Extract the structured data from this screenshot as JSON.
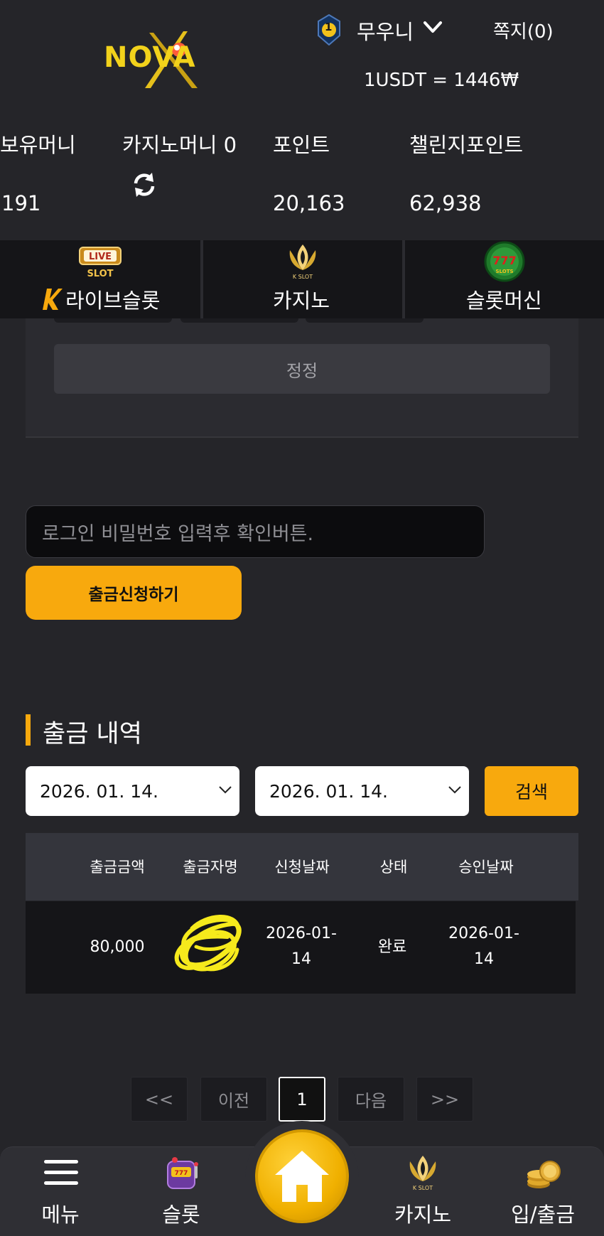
{
  "header": {
    "logo_text": "NOVA",
    "level": "1",
    "username": "무우니",
    "inbox": "쪽지(0)",
    "rate": "1USDT = 1446₩"
  },
  "wallet": {
    "held_money_label": "보유머니",
    "held_money_value": "191",
    "casino_money_label": "카지노머니 0",
    "point_label": "포인트",
    "point_value": "20,163",
    "challenge_point_label": "챌린지포인트",
    "challenge_point_value": "62,938"
  },
  "categories": [
    {
      "label": "라이브슬롯",
      "icon": "live-slot-icon"
    },
    {
      "label": "카지노",
      "icon": "k-slot-icon"
    },
    {
      "label": "슬롯머신",
      "icon": "777-slots-icon"
    }
  ],
  "panel": {
    "fix_button": "정정"
  },
  "form": {
    "password_placeholder": "로그인 비밀번호 입력후 확인버튼.",
    "withdraw_button": "출금신청하기"
  },
  "history": {
    "title": "출금 내역",
    "date_from": "2026. 01. 14.",
    "date_to": "2026. 01. 14.",
    "search_button": "검색",
    "columns": [
      "출금금액",
      "출금자명",
      "신청날짜",
      "상태",
      "승인날짜"
    ],
    "rows": [
      {
        "amount": "80,000",
        "name": "",
        "request_date_1": "2026-01-",
        "request_date_2": "14",
        "status": "완료",
        "approve_date_1": "2026-01-",
        "approve_date_2": "14"
      }
    ]
  },
  "pagination": {
    "first": "<<",
    "prev": "이전",
    "current": "1",
    "next": "다음",
    "last": ">>"
  },
  "bottom_nav": {
    "menu": "메뉴",
    "slot": "슬롯",
    "casino": "카지노",
    "deposit_withdraw": "입/출금"
  },
  "colors": {
    "accent": "#f8a90d",
    "background": "#252529",
    "logo_yellow": "#f2d21b",
    "redaction": "#f6ea1c"
  }
}
